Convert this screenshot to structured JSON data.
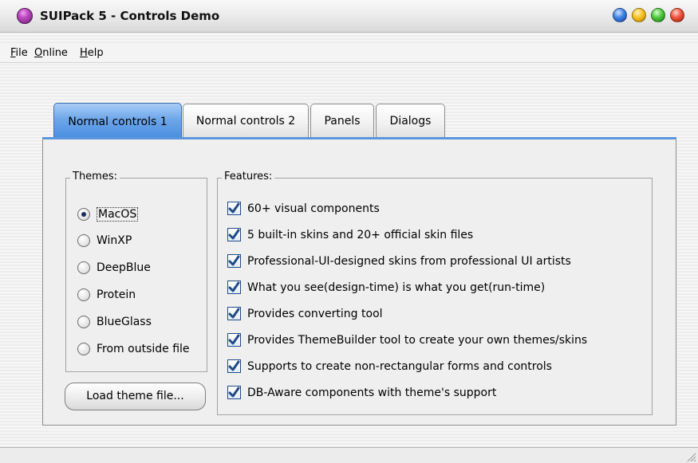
{
  "window": {
    "title": "SUIPack 5 - Controls Demo",
    "buttons": [
      "minimize-icon",
      "restore-icon",
      "maximize-icon",
      "close-icon"
    ]
  },
  "menu": {
    "file": "File",
    "online": "Online",
    "help": "Help"
  },
  "tabs": [
    {
      "label": "Normal controls 1",
      "selected": true
    },
    {
      "label": "Normal controls 2",
      "selected": false
    },
    {
      "label": "Panels",
      "selected": false
    },
    {
      "label": "Dialogs",
      "selected": false
    }
  ],
  "themes": {
    "label": "Themes:",
    "options": [
      {
        "label": "MacOS",
        "selected": true
      },
      {
        "label": "WinXP",
        "selected": false
      },
      {
        "label": "DeepBlue",
        "selected": false
      },
      {
        "label": "Protein",
        "selected": false
      },
      {
        "label": "BlueGlass",
        "selected": false
      },
      {
        "label": "From outside file",
        "selected": false
      }
    ],
    "load_button": "Load theme file..."
  },
  "features": {
    "label": "Features:",
    "items": [
      {
        "label": "60+ visual components",
        "checked": true
      },
      {
        "label": "5 built-in skins and 20+ official skin files",
        "checked": true
      },
      {
        "label": "Professional-UI-designed skins from professional UI artists",
        "checked": true
      },
      {
        "label": "What you see(design-time) is what you get(run-time)",
        "checked": true
      },
      {
        "label": "Provides converting tool",
        "checked": true
      },
      {
        "label": "Provides ThemeBuilder tool to create your own themes/skins",
        "checked": true
      },
      {
        "label": "Supports to create non-rectangular forms and controls",
        "checked": true
      },
      {
        "label": "DB-Aware components with theme's support",
        "checked": true
      }
    ]
  },
  "colors": {
    "active_tab": "#6ea7ea",
    "checkmark": "#1f4a8a"
  }
}
